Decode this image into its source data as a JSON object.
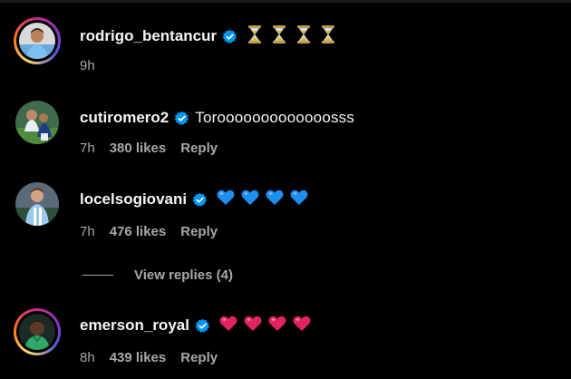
{
  "comments": [
    {
      "username": "rodrigo_bentancur",
      "verified": true,
      "text": "",
      "emoji": [
        "hourglass",
        "hourglass",
        "hourglass",
        "hourglass"
      ],
      "time": "9h",
      "likes": "",
      "reply_label": ""
    },
    {
      "username": "cutiromero2",
      "verified": true,
      "text": "Torooooooooooooosss",
      "emoji": [],
      "time": "7h",
      "likes": "380 likes",
      "reply_label": "Reply"
    },
    {
      "username": "locelsogiovani",
      "verified": true,
      "text": "",
      "emoji": [
        "blue-heart",
        "blue-heart",
        "blue-heart",
        "blue-heart"
      ],
      "time": "7h",
      "likes": "476 likes",
      "reply_label": "Reply"
    },
    {
      "username": "emerson_royal",
      "verified": true,
      "text": "",
      "emoji": [
        "red-heart",
        "red-heart",
        "red-heart",
        "red-heart"
      ],
      "time": "8h",
      "likes": "439 likes",
      "reply_label": "Reply"
    }
  ],
  "view_replies": {
    "label": "View replies (4)"
  },
  "colors": {
    "background": "#000000",
    "primary_text": "#f5f5f5",
    "secondary_text": "#a8a8a8",
    "verified_badge": "#0095f6",
    "blue_heart": "#1f8ef1",
    "red_heart": "#e0245e",
    "hourglass": "#f4b400"
  }
}
